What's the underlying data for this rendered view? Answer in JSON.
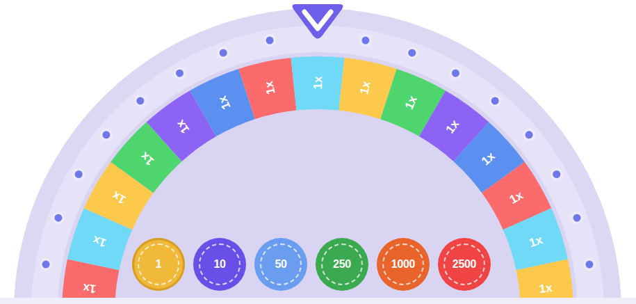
{
  "wheel": {
    "segments": [
      {
        "label": "1x",
        "color": "#fb6b6b"
      },
      {
        "label": "1x",
        "color": "#6fd9f7"
      },
      {
        "label": "1x",
        "color": "#fdc94d"
      },
      {
        "label": "1x",
        "color": "#4fd56e"
      },
      {
        "label": "1x",
        "color": "#8c63f5"
      },
      {
        "label": "1x",
        "color": "#5b8ff0"
      },
      {
        "label": "1x",
        "color": "#fb6b6b"
      },
      {
        "label": "1x",
        "color": "#6fd9f7"
      },
      {
        "label": "1x",
        "color": "#fdc94d"
      },
      {
        "label": "1x",
        "color": "#4fd56e"
      },
      {
        "label": "1x",
        "color": "#8c63f5"
      },
      {
        "label": "1x",
        "color": "#5b8ff0"
      },
      {
        "label": "1x",
        "color": "#fb6b6b"
      },
      {
        "label": "1x",
        "color": "#6fd9f7"
      },
      {
        "label": "1x",
        "color": "#fdc94d"
      }
    ]
  },
  "chips": [
    {
      "label": "1",
      "selected": true,
      "color": "#f0b93a"
    },
    {
      "label": "10",
      "selected": false,
      "color": "#6a4ee8"
    },
    {
      "label": "50",
      "selected": false,
      "color": "#6a9cf0"
    },
    {
      "label": "250",
      "selected": false,
      "color": "#3aa94f"
    },
    {
      "label": "1000",
      "selected": false,
      "color": "#e8642a"
    },
    {
      "label": "2500",
      "selected": false,
      "color": "#f04444"
    }
  ]
}
